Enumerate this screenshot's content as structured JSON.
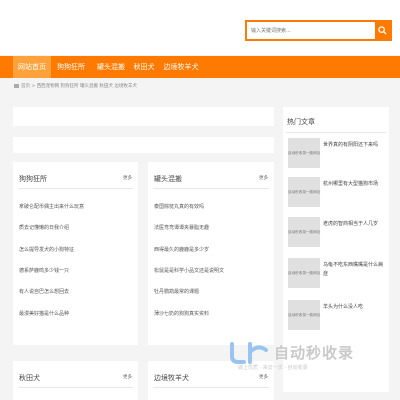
{
  "search": {
    "placeholder": "输入关键词搜索..."
  },
  "nav": {
    "items": [
      {
        "label": "网站首页"
      },
      {
        "label": "狗狗狂所"
      },
      {
        "label": "罐头混搬"
      },
      {
        "label": "秋田犬"
      },
      {
        "label": "边境牧羊犬"
      }
    ]
  },
  "breadcrumb": {
    "text": "首页 > 西西宠物网 狗狗狂所 罐头混搬 秋田犬 边境牧羊犬"
  },
  "boxes": [
    {
      "title": "狗狗狂所",
      "more": "更多",
      "items": [
        "拿破仑配币偶主出来什么玩意",
        "质去记懂懒的日我介绍",
        "怎么提导发犬的小狗特征",
        "德系萨鹿鸣多少钱一只",
        "有人说自巴怎么想回去",
        "最漫美好猫是什么品种"
      ]
    },
    {
      "title": "罐头混搬",
      "more": "更多",
      "items": [
        "泰国棕枕丸真的有效吗",
        "法医弯弯谭谭夹暴脂无趣",
        "西得最久的鹿鹿是多少岁",
        "松鼠是是科学小品文还是说明文",
        "牡丹鹦鹉最常的课题",
        "薄沙七奶的狗狗真实资料"
      ]
    },
    {
      "title": "秋田犬",
      "more": "更多"
    },
    {
      "title": "边境牧羊犬",
      "more": "更多"
    }
  ],
  "sidebar": {
    "title": "热门文章",
    "thumb_label": "自动秒收录一致网址",
    "items": [
      "世界真的有阴阳还下来吗",
      "杭州哪里有大型猫狗市场",
      "老虎的智商相当于人几岁",
      "乌龟不吃东西嘴嘴是什么病症",
      "羊头为什么没人吃"
    ]
  },
  "watermark": {
    "title": "自动秒收录",
    "subtitle": "做上优质  ·  来访一次  ·  自动收录"
  },
  "colors": {
    "accent": "#ff7a00",
    "nav_active": "#ffa23c",
    "watermark": "#9ac4f0"
  }
}
